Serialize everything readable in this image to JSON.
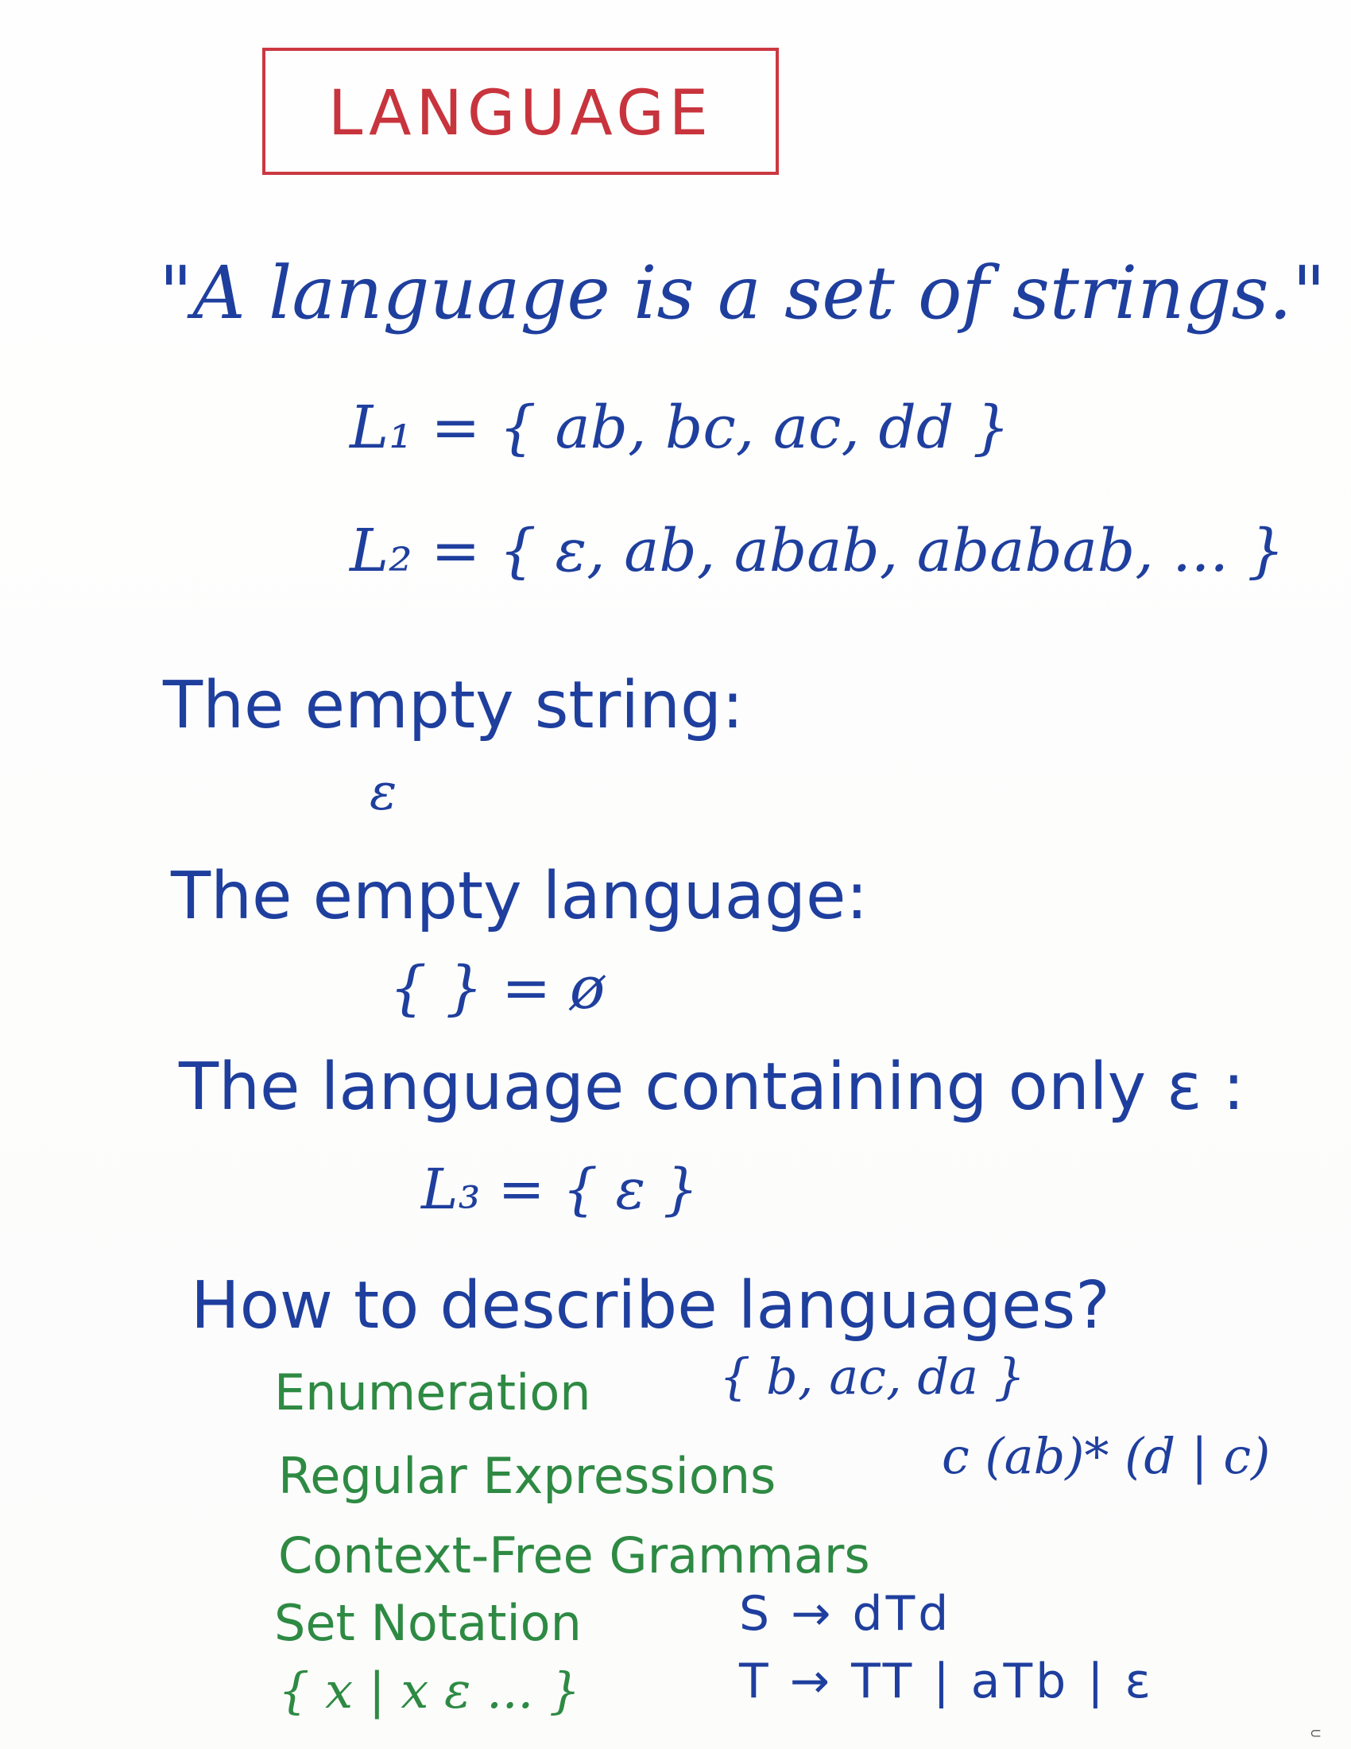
{
  "title": "LANGUAGE",
  "definition": "\"A language is a set of strings.\"",
  "examples": {
    "l1": "L₁ = { ab, bc, ac, dd }",
    "l2": "L₂ = { ε, ab, abab, ababab, ... }"
  },
  "empty_string": {
    "heading": "The empty string:",
    "symbol": "ε"
  },
  "empty_language": {
    "heading": "The empty language:",
    "expression": "{ } = ø"
  },
  "epsilon_language": {
    "heading": "The language containing only ε :",
    "expression": "L₃ = { ε }"
  },
  "describe": {
    "heading": "How to describe languages?",
    "methods": {
      "enumeration": "Enumeration",
      "enumeration_example": "{ b, ac, da }",
      "regex": "Regular Expressions",
      "regex_example": "c (ab)* (d | c)",
      "cfg": "Context-Free Grammars",
      "set_notation": "Set Notation",
      "set_notation_example": "{ x | x ε ... }"
    },
    "grammar": {
      "rule_1": "S → dTd",
      "rule_2": "T → TT | aTb | ε"
    }
  },
  "page_mark": "⊂",
  "colors": {
    "blue_ink": "#1f3f9e",
    "green_ink": "#2e8a43",
    "red_ink": "#c8343d"
  }
}
